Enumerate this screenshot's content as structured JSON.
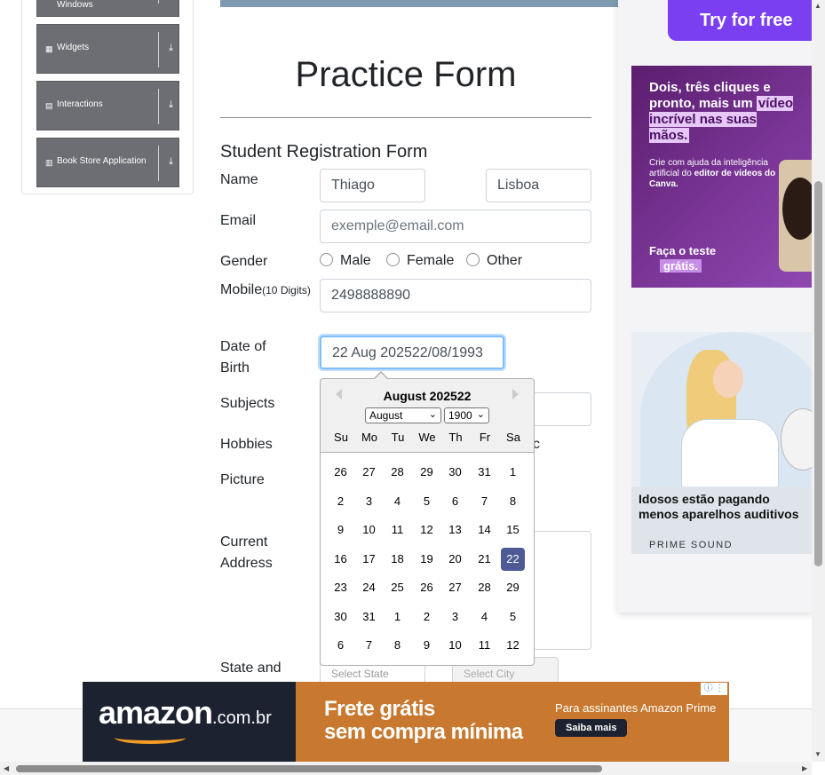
{
  "sidebar": {
    "groups": [
      {
        "label": "Windows",
        "icon": "book-icon"
      },
      {
        "label": "Widgets",
        "icon": "grid-icon"
      },
      {
        "label": "Interactions",
        "icon": "square-icon"
      },
      {
        "label": "Book Store Application",
        "icon": "library-icon"
      }
    ]
  },
  "form": {
    "title": "Practice Form",
    "subtitle": "Student Registration Form",
    "labels": {
      "name": "Name",
      "email": "Email",
      "gender": "Gender",
      "mobile": "Mobile",
      "mobile_hint": "(10 Digits)",
      "dob_line1": "Date of",
      "dob_line2": "Birth",
      "subjects": "Subjects",
      "hobbies": "Hobbies",
      "picture": "Picture",
      "address_line1": "Current",
      "address_line2": "Address",
      "state_city": "State and"
    },
    "first_name": "Thiago",
    "last_name": "Lisboa",
    "email_placeholder": "exemple@email.com",
    "genders": [
      "Male",
      "Female",
      "Other"
    ],
    "mobile_value": "2498888890",
    "dob_value": "22 Aug 202522/08/1993",
    "hobbies_partial": "c",
    "state_placeholder": "Select State",
    "city_placeholder": "Select City"
  },
  "datepicker": {
    "header": "August 202522",
    "month_select": "August",
    "year_select": "1900",
    "weekdays": [
      "Su",
      "Mo",
      "Tu",
      "We",
      "Th",
      "Fr",
      "Sa"
    ],
    "weeks": [
      [
        "26",
        "27",
        "28",
        "29",
        "30",
        "31",
        "1"
      ],
      [
        "2",
        "3",
        "4",
        "5",
        "6",
        "7",
        "8"
      ],
      [
        "9",
        "10",
        "11",
        "12",
        "13",
        "14",
        "15"
      ],
      [
        "16",
        "17",
        "18",
        "19",
        "20",
        "21",
        "22"
      ],
      [
        "23",
        "24",
        "25",
        "26",
        "27",
        "28",
        "29"
      ],
      [
        "30",
        "31",
        "1",
        "2",
        "3",
        "4",
        "5"
      ],
      [
        "6",
        "7",
        "8",
        "9",
        "10",
        "11",
        "12"
      ]
    ],
    "selected_day": "22"
  },
  "ads": {
    "try_free": "Try for free",
    "canva_headline_1": "Dois, três cliques e pronto, mais um",
    "canva_headline_hl": "vídeo incrível nas suas mãos.",
    "canva_body_1": "Crie com ajuda da inteligência artificial do",
    "canva_body_bold": "editor de vídeos do Canva.",
    "canva_cta_1": "Faça o teste",
    "canva_cta_2": "grátis.",
    "prime_headline": "Idosos estão pagando menos aparelhos auditivos",
    "prime_brand": "PRIME SOUND",
    "amazon_logo": "amazon",
    "amazon_domain": ".com.br",
    "amazon_line1": "Frete grátis",
    "amazon_line2": "sem compra mínima",
    "amazon_prime": "Para assinantes Amazon Prime",
    "amazon_cta": "Saiba mais",
    "adinfo": "ⓘ ⋮"
  },
  "colors": {
    "selected_day_bg": "#4d5a94",
    "sidebar_group_bg": "#6c6e73",
    "canva_bg": "#7a3596",
    "amazon_orange": "#c8792f"
  }
}
